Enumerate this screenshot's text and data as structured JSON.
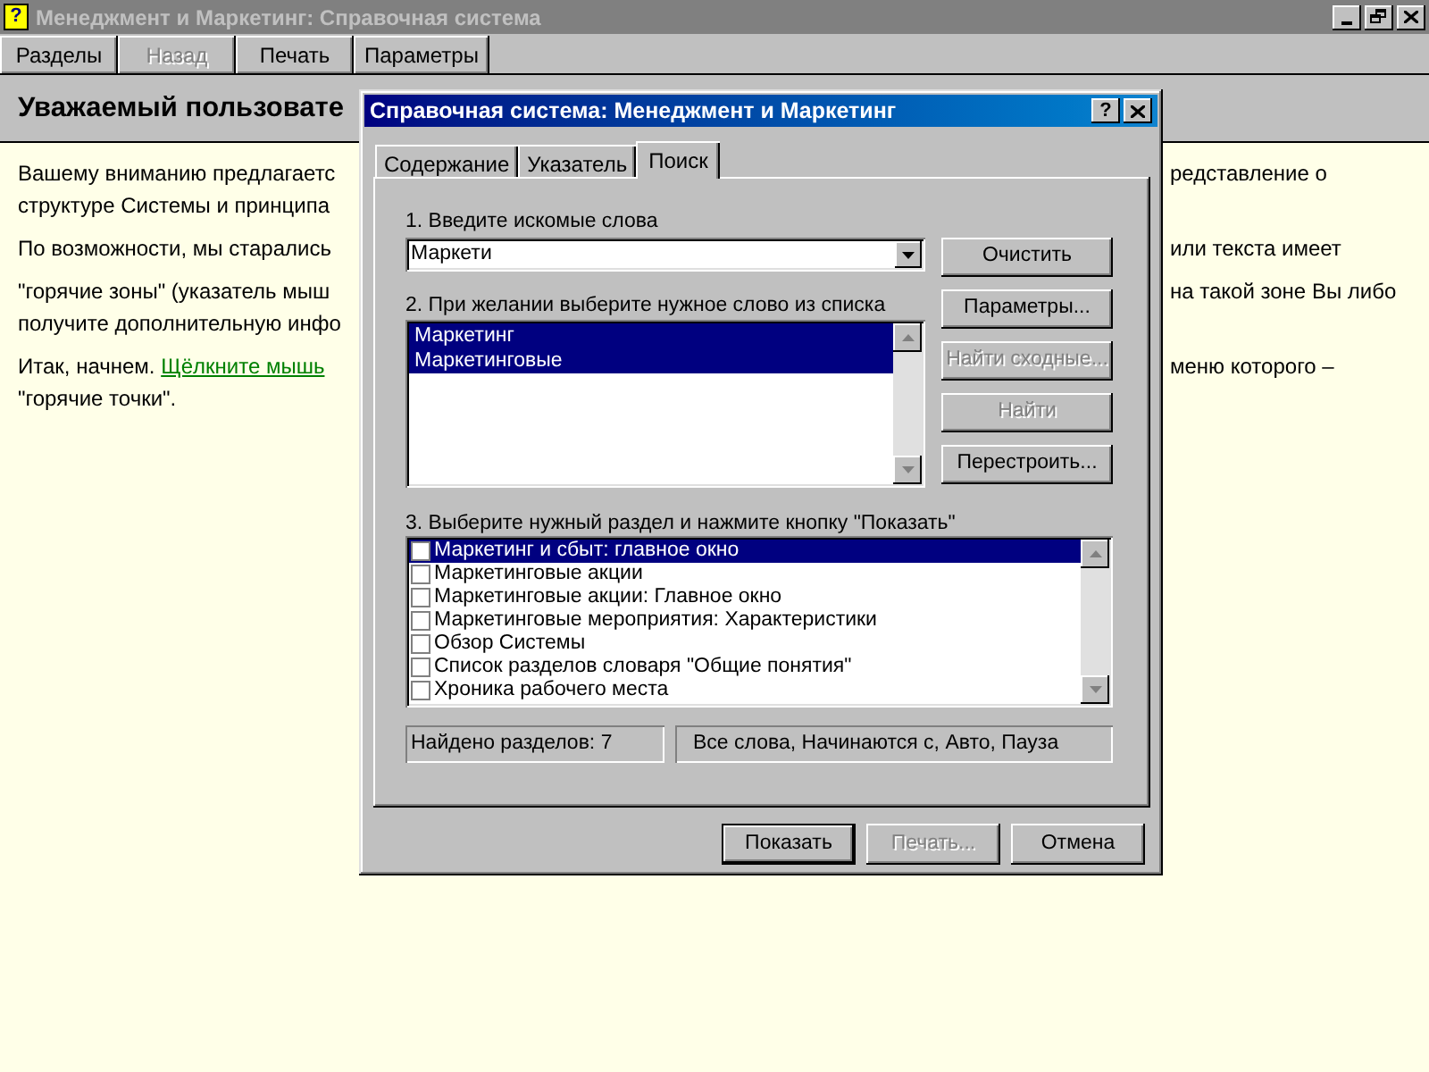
{
  "window": {
    "title": "Менеджмент и Маркетинг: Справочная система",
    "icon_text": "?"
  },
  "toolbar": [
    {
      "label": "Разделы",
      "disabled": false
    },
    {
      "label": "Назад",
      "disabled": true
    },
    {
      "label": "Печать",
      "disabled": false
    },
    {
      "label": "Параметры",
      "disabled": false
    }
  ],
  "topic": {
    "heading": "Уважаемый пользовате",
    "paragraphs": [
      {
        "lines": [
          {
            "segments": [
              {
                "kind": "text",
                "text": "Вашему вниманию предлагаетс"
              }
            ],
            "right": "редставление о"
          },
          {
            "segments": [
              {
                "kind": "text",
                "text": "структуре Системы и принципа"
              }
            ]
          }
        ]
      },
      {
        "lines": [
          {
            "segments": [
              {
                "kind": "text",
                "text": "По возможности, мы старались"
              }
            ],
            "right": "или текста имеет"
          }
        ]
      },
      {
        "lines": [
          {
            "segments": [
              {
                "kind": "text",
                "text": "\"горячие зоны\" (указатель мыш"
              }
            ],
            "right": "на такой зоне Вы либо"
          },
          {
            "segments": [
              {
                "kind": "text",
                "text": "получите дополнительную инфо"
              }
            ]
          }
        ]
      },
      {
        "lines": [
          {
            "segments": [
              {
                "kind": "text",
                "text": "Итак, начнем. "
              },
              {
                "kind": "link",
                "text": "Щёлкните мышь"
              }
            ],
            "right": "меню которого –"
          },
          {
            "segments": [
              {
                "kind": "text",
                "text": "\"горячие точки\"."
              }
            ]
          }
        ]
      }
    ]
  },
  "dialog": {
    "title": "Справочная система: Менеджмент и Маркетинг",
    "help_text": "?",
    "tabs": [
      {
        "label": "Содержание",
        "selected": false
      },
      {
        "label": "Указатель",
        "selected": false
      },
      {
        "label": "Поиск",
        "selected": true
      }
    ],
    "step1_label": "1. Введите искомые слова",
    "search_value": "Маркети",
    "step2_label": "2. При желании выберите нужное слово из списка",
    "words": [
      {
        "text": "Маркетинг",
        "selected": true
      },
      {
        "text": "Маркетинговые",
        "selected": true
      }
    ],
    "side_buttons": [
      {
        "label": "Очистить",
        "disabled": false
      },
      {
        "label": "Параметры...",
        "disabled": false
      },
      {
        "label": "Найти сходные...",
        "disabled": true
      },
      {
        "label": "Найти",
        "disabled": true
      },
      {
        "label": "Перестроить...",
        "disabled": false
      }
    ],
    "step3_label": "3. Выберите нужный раздел и нажмите кнопку \"Показать\"",
    "topics": [
      {
        "text": "Маркетинг и сбыт: главное окно",
        "checked": false,
        "selected": true
      },
      {
        "text": "Маркетинговые акции",
        "checked": false,
        "selected": false
      },
      {
        "text": "Маркетинговые акции: Главное окно",
        "checked": false,
        "selected": false
      },
      {
        "text": "Маркетинговые мероприятия: Характеристики",
        "checked": false,
        "selected": false
      },
      {
        "text": "Обзор Системы",
        "checked": false,
        "selected": false
      },
      {
        "text": "Список разделов словаря \"Общие понятия\"",
        "checked": false,
        "selected": false
      },
      {
        "text": "Хроника рабочего места",
        "checked": false,
        "selected": false
      }
    ],
    "found_count": "Найдено разделов: 7",
    "search_options": "Все слова, Начинаются с, Авто, Пауза",
    "bottom_buttons": [
      {
        "label": "Показать",
        "disabled": false,
        "default": true
      },
      {
        "label": "Печать...",
        "disabled": true,
        "default": false
      },
      {
        "label": "Отмена",
        "disabled": false,
        "default": false
      }
    ]
  }
}
